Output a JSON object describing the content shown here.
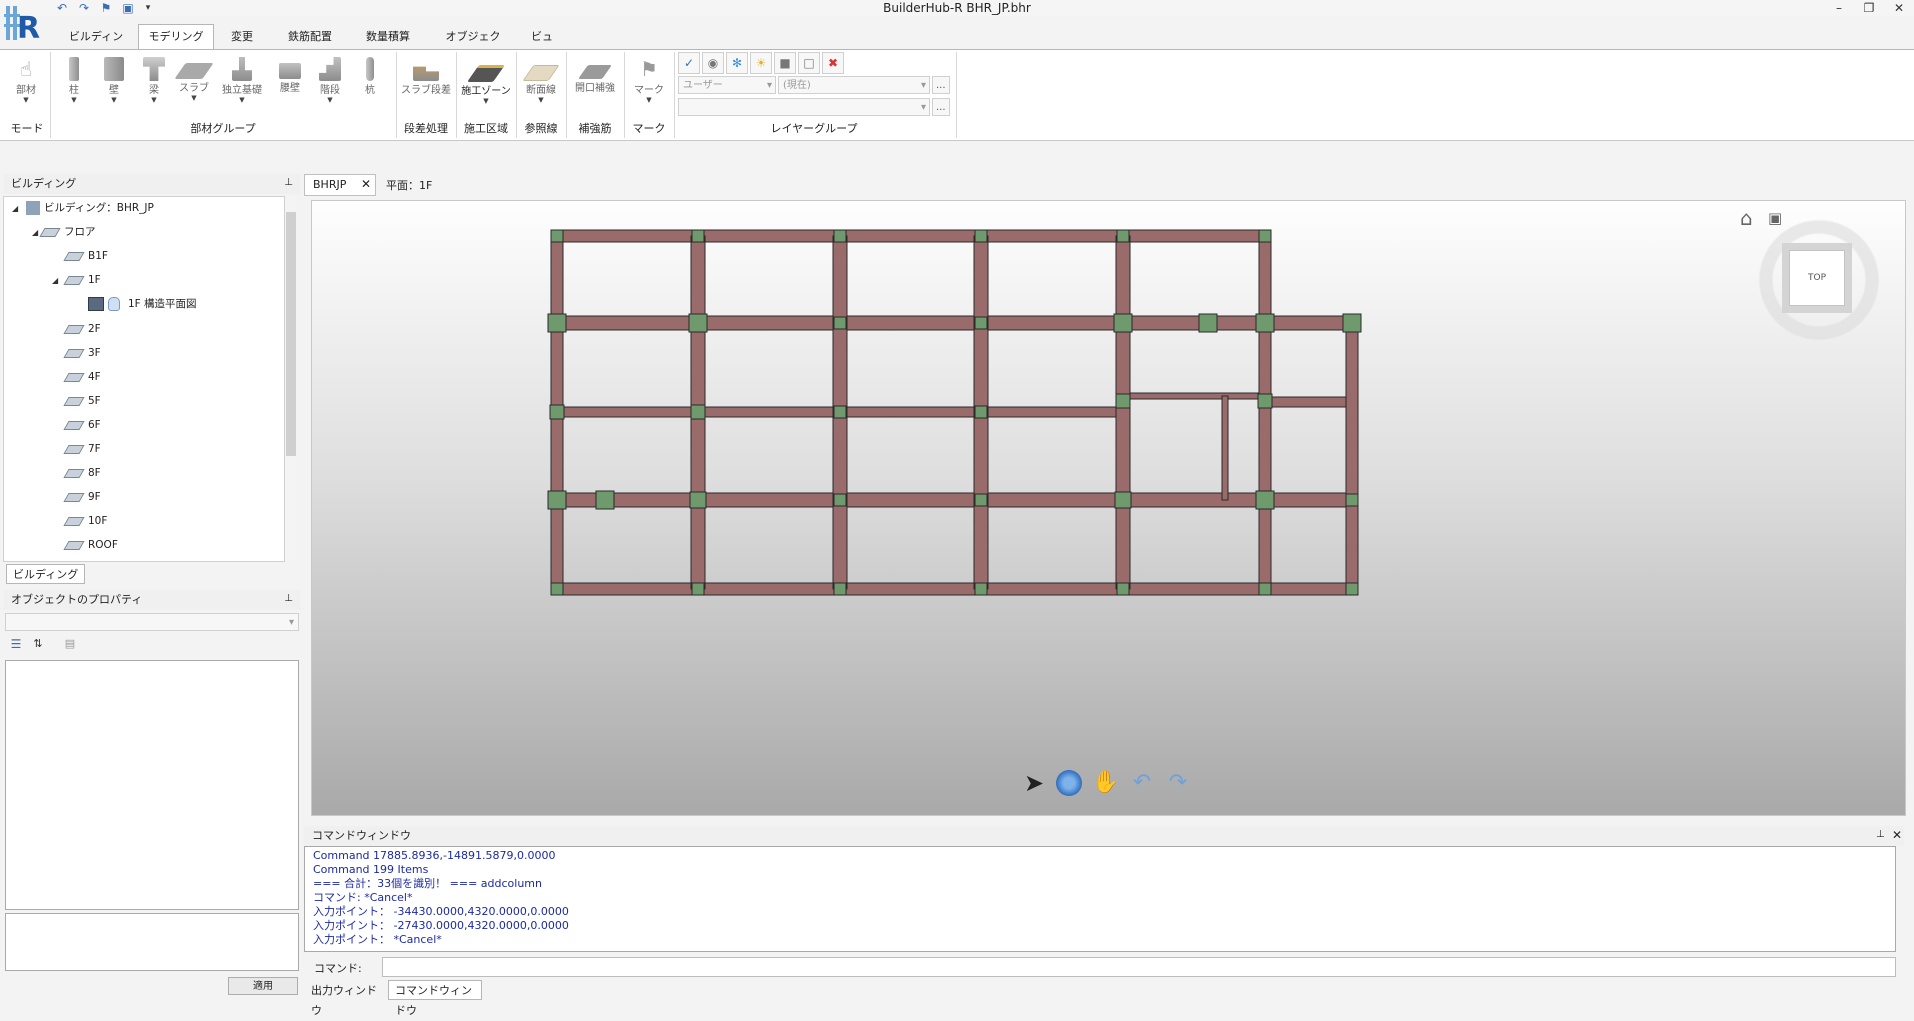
{
  "window": {
    "title": "BuilderHub-R BHR_JP.bhr"
  },
  "icons": {
    "logo": "app-logo-icon",
    "undo": "undo-icon",
    "redo": "redo-icon",
    "save": "save-icon",
    "minimize": "minimize-icon",
    "restore": "restore-icon",
    "close": "close-icon"
  },
  "ribbon": {
    "tabs": [
      {
        "label": "ビルディング"
      },
      {
        "label": "モデリング",
        "active": true
      },
      {
        "label": "変更"
      },
      {
        "label": "鉄筋配置"
      },
      {
        "label": "数量積算"
      },
      {
        "label": "オブジェクト"
      },
      {
        "label": "ビュー"
      }
    ],
    "mode": {
      "button": "部材",
      "group": "モード"
    },
    "member_group": {
      "buttons": [
        "柱",
        "壁",
        "梁",
        "スラブ",
        "独立基礎",
        "腰壁",
        "階段",
        "杭"
      ],
      "label": "部材グループ"
    },
    "slab_step": {
      "button": "スラブ段差",
      "group": "段差処理"
    },
    "zone": {
      "button": "施工ゾーン",
      "group": "施工区域"
    },
    "section": {
      "button": "断面線",
      "group": "参照線"
    },
    "rebar": {
      "button": "開口補強",
      "group": "補強筋"
    },
    "mark": {
      "button": "マーク",
      "group": "マーク"
    },
    "layer": {
      "combo_user": "ユーザー",
      "combo_current": "(現在)",
      "group": "レイヤーグループ",
      "more": "..."
    }
  },
  "left_panel": {
    "title": "ビルディング",
    "tree": {
      "building": "ビルディング：BHR_JP",
      "floor_root": "フロア",
      "floors": [
        "B1F",
        "1F",
        "2F",
        "3F",
        "4F",
        "5F",
        "6F",
        "7F",
        "8F",
        "9F",
        "10F",
        "ROOF"
      ],
      "view": "1F 構造平面図"
    },
    "tab": "ビルディング"
  },
  "properties_panel": {
    "title": "オブジェクトのプロパティ",
    "apply": "適用"
  },
  "document": {
    "tab": "BHRJP",
    "close": "✕",
    "view_label": "平面：1F"
  },
  "viewcube": {
    "face": "TOP"
  },
  "command_window": {
    "title": "コマンドウィンドウ",
    "lines": [
      "Command 17885.8936,-14891.5879,0.0000",
      "Command 199 Items",
      "=== 合計：33個を識別！ === addcolumn",
      "コマンド: *Cancel*",
      "入力ポイント： -34430.0000,4320.0000,0.0000",
      "入力ポイント： -27430.0000,4320.0000,0.0000",
      "入力ポイント： *Cancel*"
    ],
    "prompt": "コマンド:",
    "bottom_tabs": [
      "出力ウィンドウ",
      "コマンドウィンドウ"
    ]
  },
  "colors": {
    "beam": "#9a6b6b",
    "column": "#6e9a6e",
    "accent": "#3a6db5"
  }
}
